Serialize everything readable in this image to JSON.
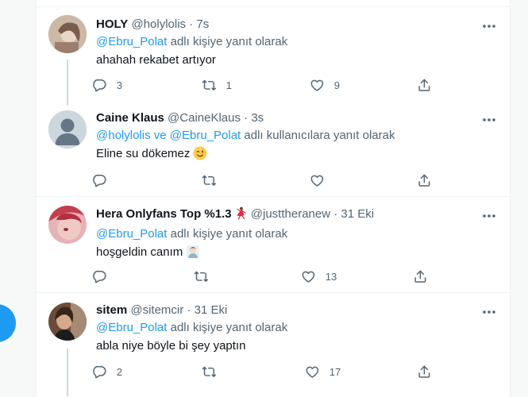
{
  "tweets": [
    {
      "name": "HOLY",
      "handle": "@holylolis",
      "sep": "·",
      "time": "7s",
      "reply_prefix": "",
      "reply_mentions": "@Ebru_Polat",
      "reply_suffix": " adlı kişiye yanıt olarak",
      "text": "ahahah rekabet artıyor",
      "counts": {
        "reply": "3",
        "retweet": "1",
        "like": "9"
      }
    },
    {
      "name": "Caine Klaus",
      "handle": "@CaineKlaus",
      "sep": "·",
      "time": "3s",
      "reply_mentions": "@holylolis ve @Ebru_Polat",
      "reply_suffix": " adlı kullanıcılara yanıt olarak",
      "text": "Eline su dökemez",
      "text_emoji": "winking-face",
      "counts": {
        "reply": "",
        "retweet": "",
        "like": ""
      }
    },
    {
      "name": "Hera Onlyfans Top %1.3",
      "name_emoji": "dancer",
      "handle": "@justtheranew",
      "sep": "·",
      "time": "31 Eki",
      "reply_mentions": "@Ebru_Polat",
      "reply_suffix": " adlı kişiye yanıt olarak",
      "text": "hoşgeldin canım",
      "text_emoji": "sticker",
      "counts": {
        "reply": "",
        "retweet": "",
        "like": "13"
      }
    },
    {
      "name": "sitem",
      "handle": "@sitemcir",
      "sep": "·",
      "time": "31 Eki",
      "reply_mentions": "@Ebru_Polat",
      "reply_suffix": " adlı kişiye yanıt olarak",
      "text": "abla niye böyle bi şey yaptın",
      "counts": {
        "reply": "2",
        "retweet": "",
        "like": "17"
      }
    }
  ],
  "icons": {
    "more": "more-horizontal-icon",
    "reply": "reply-icon",
    "retweet": "retweet-icon",
    "like": "like-icon",
    "share": "share-icon"
  },
  "colors": {
    "accent": "#1d9bf0",
    "text": "#0f1419",
    "muted": "#536471",
    "border": "#eff3f4"
  }
}
